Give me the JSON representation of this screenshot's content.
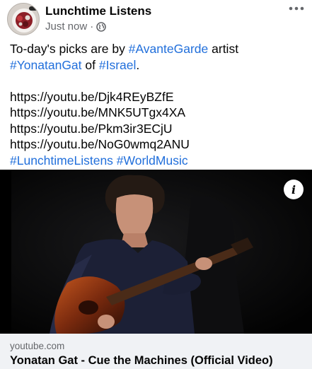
{
  "post": {
    "page_name": "Lunchtime Listens",
    "time": "Just now",
    "separator": "·",
    "privacy_icon": "globe-icon",
    "more_icon": "more-horizontal-icon",
    "text": {
      "line1": {
        "a": "To-day's picks are by ",
        "b": "#AvanteGarde",
        "c": " artist"
      },
      "line2": {
        "a": "#YonatanGat",
        "b": " of ",
        "c": "#Israel",
        "d": "."
      },
      "links": [
        "https://youtu.be/Djk4REyBZfE",
        "https://youtu.be/MNK5UTgx4XA",
        "https://youtu.be/Pkm3ir3ECjU",
        "https://youtu.be/NoG0wmq2ANU"
      ],
      "hashtags": {
        "a": "#LunchtimeListens",
        "b": "#WorldMusic"
      }
    }
  },
  "media": {
    "info_label": "i",
    "info_icon": "info-icon"
  },
  "link_preview": {
    "domain": "youtube.com",
    "title": "Yonatan Gat - Cue the Machines (Official Video)"
  },
  "colors": {
    "hashtag": "#216fdb",
    "secondary_text": "#65676b",
    "link_card_bg": "#f0f2f5"
  }
}
